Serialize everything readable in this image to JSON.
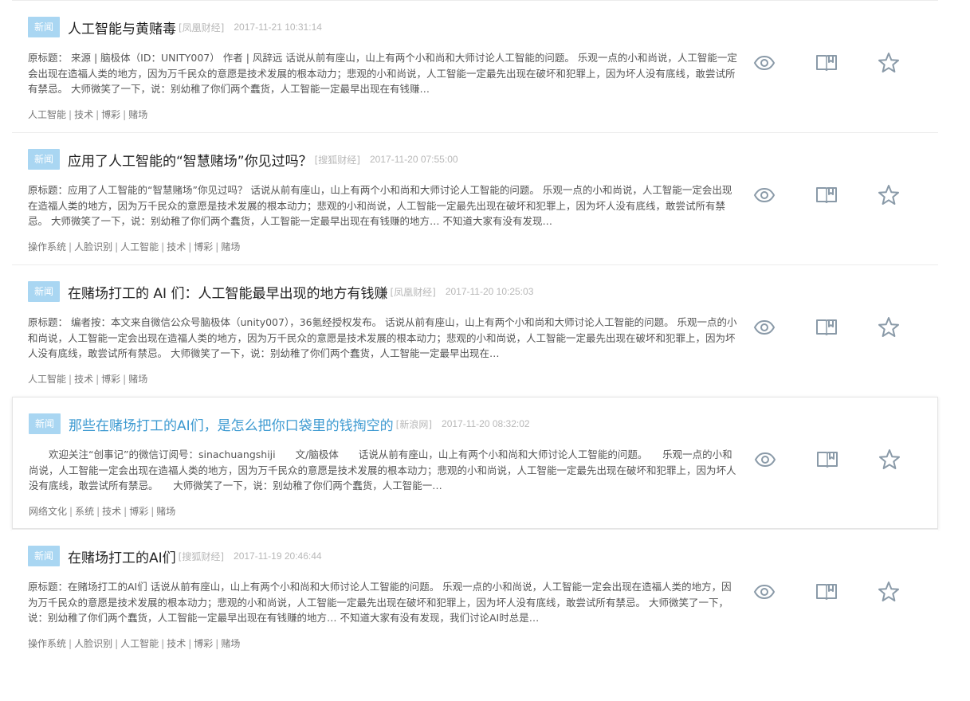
{
  "news": [
    {
      "badge": "新闻",
      "title": "人工智能与黄赌毒",
      "source": "[凤凰财经]",
      "time": "2017-11-21 10:31:14",
      "summary": "原标题： 来源 | 脑极体（ID：UNITY007） 作者 | 风辞远 话说从前有座山，山上有两个小和尚和大师讨论人工智能的问题。 乐观一点的小和尚说，人工智能一定会出现在造福人类的地方，因为万千民众的意愿是技术发展的根本动力；悲观的小和尚说，人工智能一定最先出现在破坏和犯罪上，因为坏人没有底线，敢尝试所有禁忌。 大师微笑了一下，说：别幼稚了你们两个蠢货，人工智能一定最早出现在有钱赚…",
      "tags": [
        "人工智能",
        "技术",
        "博彩",
        "赌场"
      ],
      "highlight": false
    },
    {
      "badge": "新闻",
      "title": "应用了人工智能的“智慧赌场”你见过吗？",
      "source": "[搜狐财经]",
      "time": "2017-11-20 07:55:00",
      "summary": "原标题：应用了人工智能的“智慧赌场”你见过吗？ 话说从前有座山，山上有两个小和尚和大师讨论人工智能的问题。 乐观一点的小和尚说，人工智能一定会出现在造福人类的地方，因为万千民众的意愿是技术发展的根本动力；悲观的小和尚说，人工智能一定最先出现在破坏和犯罪上，因为坏人没有底线，敢尝试所有禁忌。 大师微笑了一下，说：别幼稚了你们两个蠢货，人工智能一定最早出现在有钱赚的地方… 不知道大家有没有发现…",
      "tags": [
        "操作系统",
        "人脸识别",
        "人工智能",
        "技术",
        "博彩",
        "赌场"
      ],
      "highlight": false
    },
    {
      "badge": "新闻",
      "title": "在赌场打工的 AI 们：人工智能最早出现的地方有钱赚",
      "source": "[凤凰财经]",
      "time": "2017-11-20 10:25:03",
      "summary": "原标题： 编者按：本文来自微信公众号脑极体（unity007），36氪经授权发布。 话说从前有座山，山上有两个小和尚和大师讨论人工智能的问题。 乐观一点的小和尚说，人工智能一定会出现在造福人类的地方，因为万千民众的意愿是技术发展的根本动力；悲观的小和尚说，人工智能一定最先出现在破坏和犯罪上，因为坏人没有底线，敢尝试所有禁忌。 大师微笑了一下，说：别幼稚了你们两个蠢货，人工智能一定最早出现在…",
      "tags": [
        "人工智能",
        "技术",
        "博彩",
        "赌场"
      ],
      "highlight": false
    },
    {
      "badge": "新闻",
      "title": "那些在赌场打工的AI们，是怎么把你口袋里的钱掏空的",
      "source": "[新浪网]",
      "time": "2017-11-20 08:32:02",
      "summary": "　　欢迎关注“创事记”的微信订阅号：sinachuangshiji　　文/脑极体　　话说从前有座山，山上有两个小和尚和大师讨论人工智能的问题。　　乐观一点的小和尚说，人工智能一定会出现在造福人类的地方，因为万千民众的意愿是技术发展的根本动力；悲观的小和尚说，人工智能一定最先出现在破坏和犯罪上，因为坏人没有底线，敢尝试所有禁忌。　　大师微笑了一下，说：别幼稚了你们两个蠢货，人工智能一…",
      "tags": [
        "网络文化",
        "系统",
        "技术",
        "博彩",
        "赌场"
      ],
      "highlight": true
    },
    {
      "badge": "新闻",
      "title": "在赌场打工的AI们",
      "source": "[搜狐财经]",
      "time": "2017-11-19 20:46:44",
      "summary": "原标题：在赌场打工的AI们 话说从前有座山，山上有两个小和尚和大师讨论人工智能的问题。 乐观一点的小和尚说，人工智能一定会出现在造福人类的地方，因为万千民众的意愿是技术发展的根本动力；悲观的小和尚说，人工智能一定最先出现在破坏和犯罪上，因为坏人没有底线，敢尝试所有禁忌。 大师微笑了一下，说：别幼稚了你们两个蠢货，人工智能一定最早出现在有钱赚的地方… 不知道大家有没有发现，我们讨论AI时总是…",
      "tags": [
        "操作系统",
        "人脸识别",
        "人工智能",
        "技术",
        "博彩",
        "赌场"
      ],
      "highlight": false
    }
  ],
  "icons": {
    "view": "eye-icon",
    "read": "book-icon",
    "favorite": "star-icon"
  },
  "colors": {
    "badge_bg": "#a9d6f2",
    "highlight_title": "#3d9ad1",
    "icon": "#8a9aa8",
    "meta": "#b8b8b8"
  }
}
